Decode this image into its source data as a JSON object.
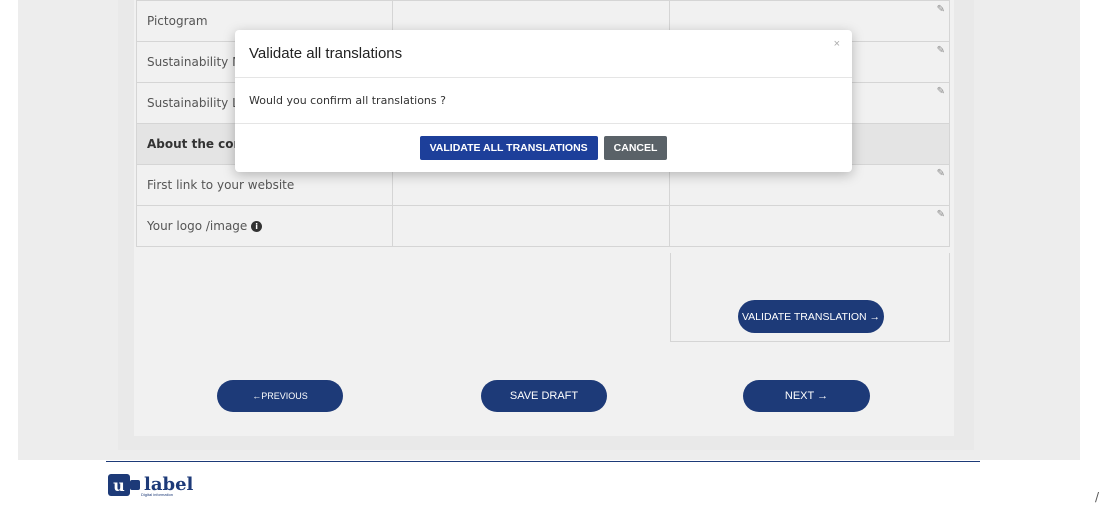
{
  "table": {
    "rows": [
      {
        "label": "Pictogram",
        "section": false
      },
      {
        "label": "Sustainability M",
        "section": false
      },
      {
        "label": "Sustainability Lc",
        "section": false
      },
      {
        "label": "About the com",
        "section": true
      },
      {
        "label": "First link to your website",
        "section": false
      },
      {
        "label": "Your logo /image",
        "section": false
      }
    ],
    "edit_icon": "✎"
  },
  "buttons": {
    "validate_translation": "VALIDATE TRANSLATION →",
    "previous": "←PREVIOUS",
    "save_draft": "SAVE DRAFT",
    "next": "NEXT →"
  },
  "logo": {
    "letter": "u",
    "text": "label",
    "subtitle": "Digital information"
  },
  "modal": {
    "title": "Validate all translations",
    "close": "×",
    "message": "Would you confirm all translations ?",
    "confirm": "VALIDATE ALL TRANSLATIONS",
    "cancel": "CANCEL"
  },
  "trail": "/",
  "colors": {
    "primary": "#1d3a78",
    "modal_primary": "#1d3f9a",
    "cancel": "#5a6268"
  }
}
